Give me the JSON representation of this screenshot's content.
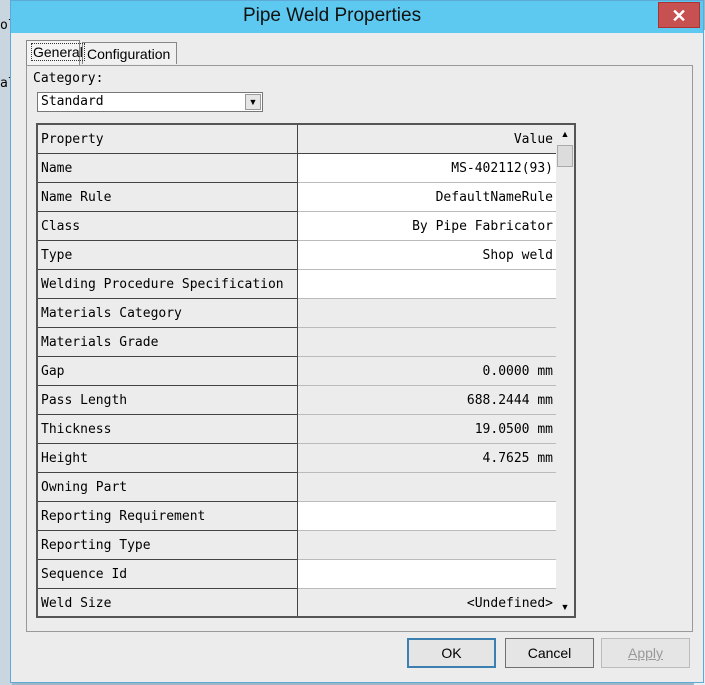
{
  "background_fragments": [
    "ol",
    "al"
  ],
  "window": {
    "title": "Pipe Weld Properties"
  },
  "tabs": [
    {
      "label": "General",
      "active": true
    },
    {
      "label": "Configuration",
      "active": false
    }
  ],
  "category": {
    "label": "Category:",
    "value": "Standard"
  },
  "grid": {
    "header": {
      "property": "Property",
      "value": "Value"
    },
    "rows": [
      {
        "property": "Name",
        "value": "MS-402112(93)",
        "editable": true
      },
      {
        "property": "Name Rule",
        "value": "DefaultNameRule",
        "editable": true
      },
      {
        "property": "Class",
        "value": "By Pipe Fabricator",
        "editable": true
      },
      {
        "property": "Type",
        "value": "Shop weld",
        "editable": true
      },
      {
        "property": "Welding Procedure Specification",
        "value": "",
        "editable": true
      },
      {
        "property": "Materials Category",
        "value": "",
        "editable": false
      },
      {
        "property": "Materials Grade",
        "value": "",
        "editable": false
      },
      {
        "property": "Gap",
        "value": "0.0000 mm",
        "editable": false
      },
      {
        "property": "Pass Length",
        "value": "688.2444 mm",
        "editable": false
      },
      {
        "property": "Thickness",
        "value": "19.0500 mm",
        "editable": false
      },
      {
        "property": "Height",
        "value": "4.7625 mm",
        "editable": false
      },
      {
        "property": "Owning Part",
        "value": "",
        "editable": false
      },
      {
        "property": "Reporting Requirement",
        "value": "",
        "editable": true
      },
      {
        "property": "Reporting Type",
        "value": "",
        "editable": false
      },
      {
        "property": "Sequence Id",
        "value": "",
        "editable": true
      },
      {
        "property": "Weld Size",
        "value": "<Undefined>",
        "editable": false
      }
    ]
  },
  "buttons": {
    "ok": "OK",
    "cancel": "Cancel",
    "apply": "Apply"
  },
  "icons": {
    "close": "close-icon",
    "dropdown": "chevron-down-icon",
    "scroll_up": "arrow-up-icon",
    "scroll_down": "arrow-down-icon"
  }
}
